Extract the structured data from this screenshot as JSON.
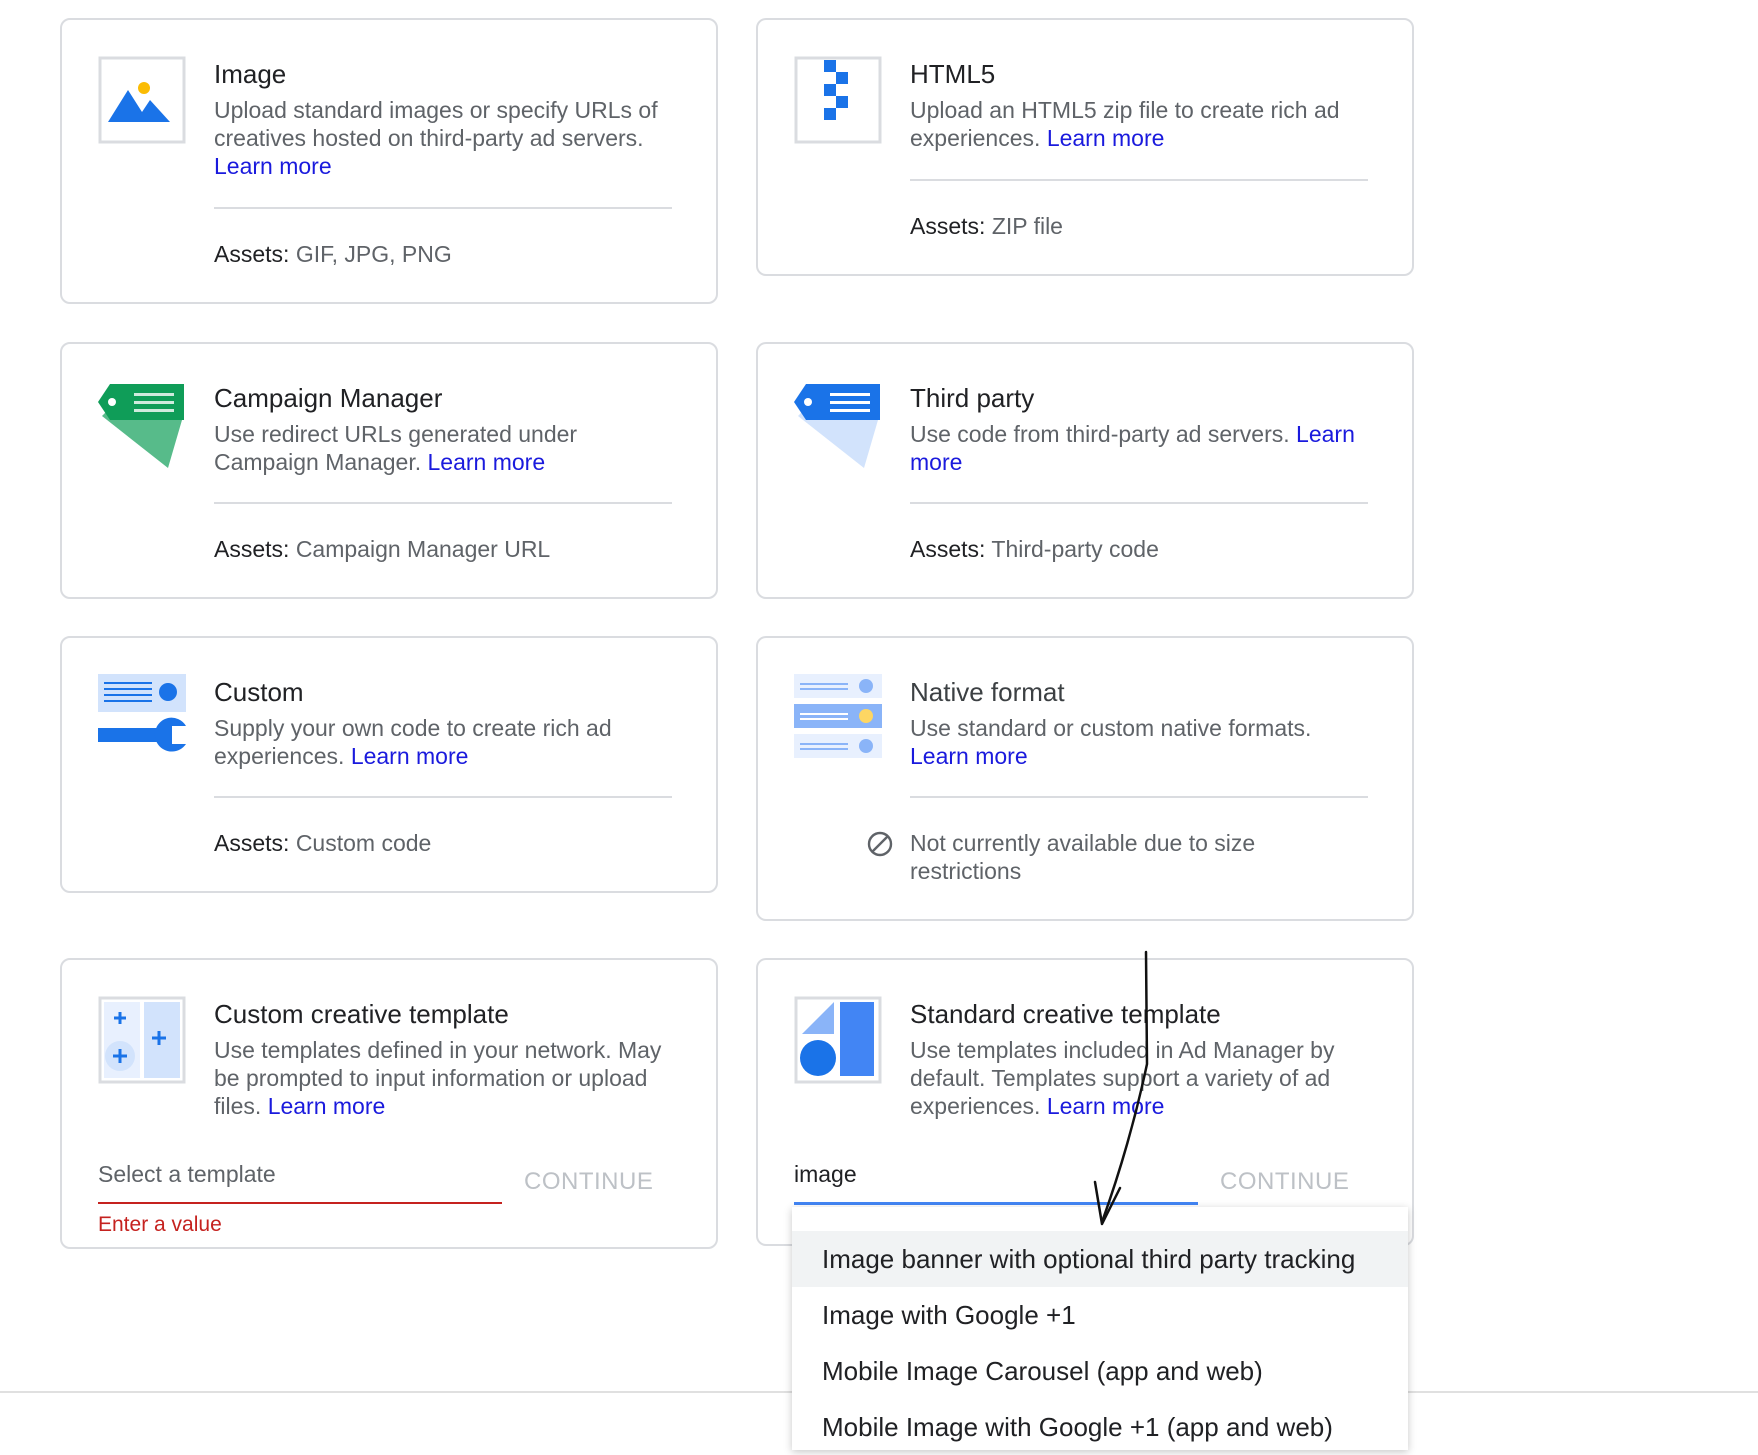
{
  "cards": {
    "image": {
      "title": "Image",
      "desc": "Upload standard images or specify URLs of creatives hosted on third-party ad servers.",
      "learn_more": "Learn more",
      "assets_label": "Assets:",
      "assets_value": "GIF, JPG, PNG",
      "icon": "image-icon"
    },
    "html5": {
      "title": "HTML5",
      "desc": "Upload an HTML5 zip file to create rich ad experiences.",
      "learn_more": "Learn more",
      "assets_label": "Assets:",
      "assets_value": "ZIP file",
      "icon": "zip-file-icon"
    },
    "campaign_manager": {
      "title": "Campaign Manager",
      "desc": "Use redirect URLs generated under Campaign Manager.",
      "learn_more": "Learn more",
      "assets_label": "Assets:",
      "assets_value": "Campaign Manager URL",
      "icon": "green-tag-icon"
    },
    "third_party": {
      "title": "Third party",
      "desc": "Use code from third-party ad servers.",
      "learn_more": "Learn more",
      "assets_label": "Assets:",
      "assets_value": "Third-party code",
      "icon": "blue-tag-icon"
    },
    "custom": {
      "title": "Custom",
      "desc": "Supply your own code to create rich ad experiences.",
      "learn_more": "Learn more",
      "assets_label": "Assets:",
      "assets_value": "Custom code",
      "icon": "custom-code-icon"
    },
    "native": {
      "title": "Native format",
      "desc": "Use standard or custom native formats.",
      "learn_more": "Learn more",
      "not_available": "Not currently available due to size restrictions",
      "icon": "native-format-icon"
    },
    "custom_template": {
      "title": "Custom creative template",
      "desc": "Use templates defined in your network. May be prompted to input information or upload files.",
      "learn_more": "Learn more",
      "placeholder": "Select a template",
      "continue": "CONTINUE",
      "error": "Enter a value",
      "icon": "template-plus-icon"
    },
    "standard_template": {
      "title": "Standard creative template",
      "desc": "Use templates included in Ad Manager by default. Templates support a variety of ad experiences.",
      "learn_more": "Learn more",
      "input_value": "image",
      "continue": "CONTINUE",
      "icon": "standard-template-icon"
    }
  },
  "dropdown": {
    "options": [
      "Image banner with optional third party tracking",
      "Image with Google +1",
      "Mobile Image Carousel (app and web)",
      "Mobile Image with Google +1 (app and web)"
    ]
  },
  "colors": {
    "link": "#1a1add",
    "error": "#c5221f",
    "accent": "#4285f4",
    "green": "#0f9d58"
  }
}
